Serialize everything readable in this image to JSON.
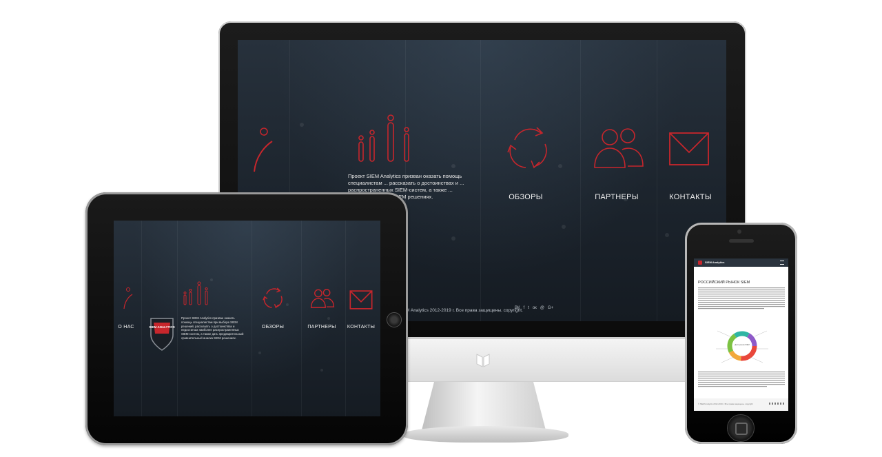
{
  "desktop": {
    "nav": [
      {
        "label": "ОБЗОРЫ"
      },
      {
        "label": "ПАРТНЕРЫ"
      },
      {
        "label": "КОНТАКТЫ"
      }
    ],
    "intro": "Проект SIEM Analytics призван оказать помощь специалистам ... рассказать о достоинствах и ... распространенных SIEM-систем, а также ... вительный анализ SIEM решениях.",
    "footer": "M Analytics 2012-2019 г. Все права защищены. copyright.",
    "social_icons": [
      "vk-icon",
      "facebook-icon",
      "twitter-icon",
      "odnoklassniki-icon",
      "mailru-icon",
      "google-plus-icon"
    ],
    "social_glyphs": [
      "ВК",
      "f",
      "t",
      "ок",
      "@",
      "G+"
    ]
  },
  "tablet": {
    "nav": [
      {
        "label": "О НАС"
      },
      {
        "label": "ОБЗОРЫ"
      },
      {
        "label": "ПАРТНЕРЫ"
      },
      {
        "label": "КОНТАКТЫ"
      }
    ],
    "intro": "Проект SIEM Analytics призван оказать помощь специалистам при выборе SIEM решений, рассказать о достоинствах и недостатках наиболее распространенных SIEM-систем, а также дать предварительный сравнительный анализ SIEM решениях.",
    "badge_text": "SIEM ANALYTICS"
  },
  "phone": {
    "header_brand": "SIEM Analytics",
    "heading": "РОССИЙСКИЙ РЫНОК SIEM",
    "chart_center_text": "Доля рынка SIEM",
    "copyright": "© SIEM Analytics 2012-2019 г. Все права защищены. copyright"
  },
  "colors": {
    "accent_red": "#c7262c",
    "screen_dark": "#1c242d",
    "device_black": "#0b0b0b"
  }
}
